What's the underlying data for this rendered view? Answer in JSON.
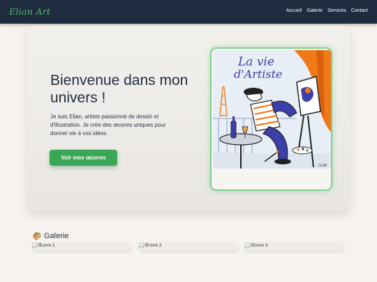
{
  "header": {
    "brand": "Elian Art",
    "nav": [
      "Accueil",
      "Galerie",
      "Services",
      "Contact"
    ]
  },
  "hero": {
    "title": "Bienvenue dans mon univers !",
    "text": "Je suis Elian, artiste passionné de dessin et d'illustration. Je crée des œuvres uniques pour donner vie à vos idées.",
    "button": "Voir mes œuvres",
    "artwork": {
      "lettering_line1": "La vie",
      "lettering_line2": "d'Artiste",
      "signature": "CLUBY"
    }
  },
  "gallery": {
    "icon": "palette-icon",
    "title": "Galerie",
    "items": [
      "Œuvre 1",
      "Œuvre 2",
      "Œuvre 3"
    ]
  },
  "colors": {
    "header_bg": "#1f2b3e",
    "accent_green": "#3aa757",
    "brand_green": "#4fbf6c",
    "page_bg": "#f5f2ef"
  }
}
